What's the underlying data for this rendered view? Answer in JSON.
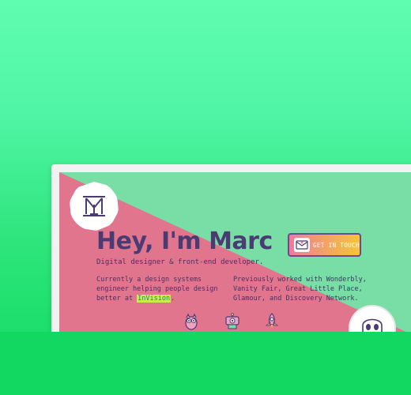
{
  "hero": {
    "title": "Hey, I'm Marc",
    "subtitle": "Digital designer & front-end developer."
  },
  "intro": {
    "text_before": "Currently a design systems engineer helping people design better at ",
    "highlight": "InVision",
    "text_after": "."
  },
  "previous": {
    "text": "Previously worked with Wonderbly, Vanity Fair, Great Little Place, Glamour, and Discovery Network."
  },
  "cta": {
    "label": "GET IN TOUCH"
  },
  "colors": {
    "background_green": "#5ffdb0",
    "screen_green": "#78dea5",
    "screen_pink": "#e1758e",
    "title_purple": "#4a3b72"
  },
  "icons": [
    "monogram-logo-icon",
    "envelope-icon",
    "ghost-mascot-icon",
    "owl-icon",
    "robot-icon",
    "rocket-icon"
  ]
}
